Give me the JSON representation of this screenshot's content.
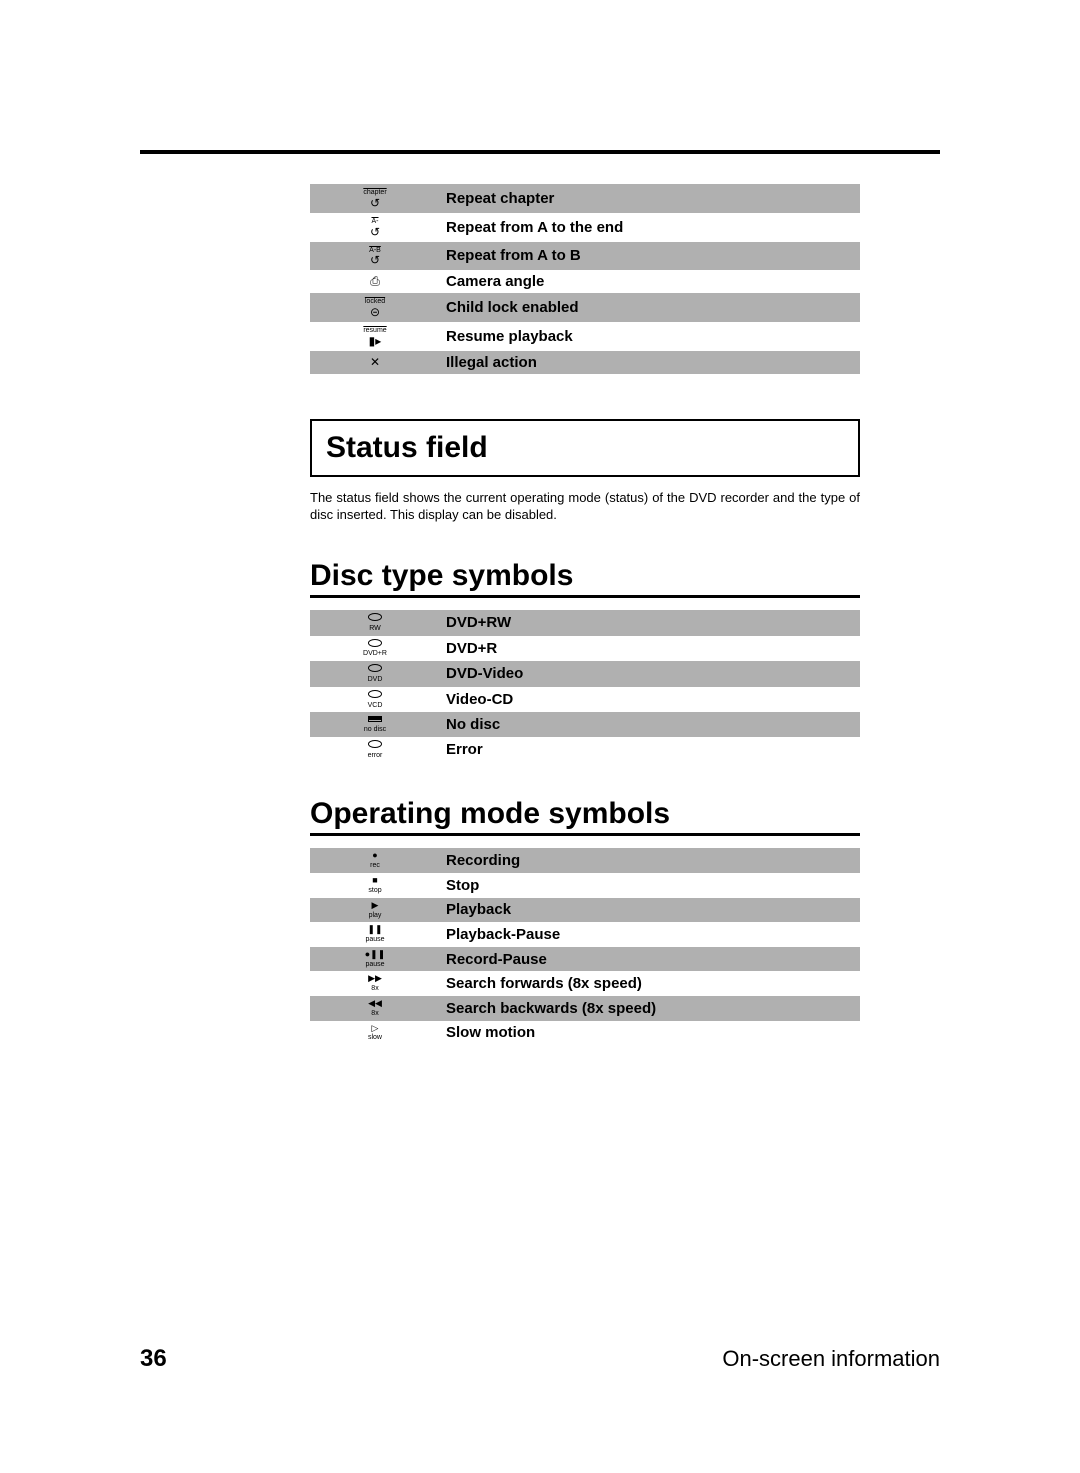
{
  "table1": {
    "rows": [
      {
        "icon_top": "chapter",
        "icon_glyph": "↺",
        "label": "Repeat chapter"
      },
      {
        "icon_top": "A-",
        "icon_glyph": "↺",
        "label": "Repeat from A to the end"
      },
      {
        "icon_top": "A-B",
        "icon_glyph": "↺",
        "label": "Repeat from A to B"
      },
      {
        "icon_top": "",
        "icon_glyph": "⎙",
        "label": "Camera angle"
      },
      {
        "icon_top": "locked",
        "icon_glyph": "⊝",
        "label": "Child lock enabled"
      },
      {
        "icon_top": "resume",
        "icon_glyph": "▮▸",
        "label": "Resume playback"
      },
      {
        "icon_top": "",
        "icon_glyph": "✕",
        "label": "Illegal action"
      }
    ]
  },
  "status_field": {
    "heading": "Status field",
    "text": "The status field shows the current operating mode (status) of the DVD recorder and the type of disc inserted. This display can be disabled."
  },
  "disc_symbols": {
    "heading": "Disc type symbols",
    "rows": [
      {
        "sub": "RW",
        "label": "DVD+RW",
        "type": "disc"
      },
      {
        "sub": "DVD+R",
        "label": "DVD+R",
        "type": "disc"
      },
      {
        "sub": "DVD",
        "label": "DVD-Video",
        "type": "disc"
      },
      {
        "sub": "VCD",
        "label": "Video-CD",
        "type": "disc"
      },
      {
        "sub": "no disc",
        "label": "No disc",
        "type": "tray"
      },
      {
        "sub": "error",
        "label": "Error",
        "type": "disc"
      }
    ]
  },
  "operating_symbols": {
    "heading": "Operating mode symbols",
    "rows": [
      {
        "glyph": "●",
        "sub": "rec",
        "label": "Recording"
      },
      {
        "glyph": "■",
        "sub": "stop",
        "label": "Stop"
      },
      {
        "glyph": "▶",
        "sub": "play",
        "label": "Playback"
      },
      {
        "glyph": "❚❚",
        "sub": "pause",
        "label": "Playback-Pause"
      },
      {
        "glyph": "●❚❚",
        "sub": "pause",
        "label": "Record-Pause"
      },
      {
        "glyph": "▶▶",
        "sub": "8x",
        "label": "Search forwards (8x speed)"
      },
      {
        "glyph": "◀◀",
        "sub": "8x",
        "label": "Search backwards (8x speed)"
      },
      {
        "glyph": "▷",
        "sub": "slow",
        "label": "Slow motion"
      }
    ]
  },
  "footer": {
    "page": "36",
    "title": "On-screen information"
  }
}
